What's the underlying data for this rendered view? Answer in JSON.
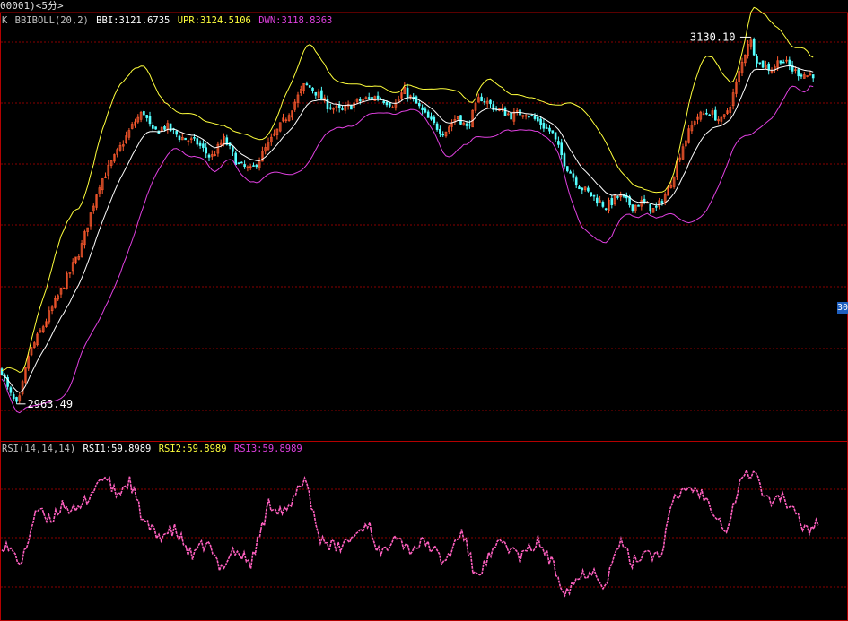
{
  "window_title": "00001)<5分>",
  "main_legend": {
    "prefix": "K",
    "indicator": "BBIBOLL(20,2)",
    "bbi": "BBI:3121.6735",
    "upr": "UPR:3124.5106",
    "dwn": "DWN:3118.8363"
  },
  "rsi_legend": {
    "indicator": "RSI(14,14,14)",
    "rsi1": "RSI1:59.8989",
    "rsi2": "RSI2:59.8989",
    "rsi3": "RSI3:59.8989"
  },
  "right_tag": "30",
  "colors": {
    "background": "#000000",
    "frame": "#b40000",
    "grid": "#8a0000",
    "up_candle": "#ff5a2e",
    "down_candle": "#54ffff",
    "bbi": "#ffffff",
    "upr": "#ffff3c",
    "dwn": "#e040e0",
    "rsi": "#ff60c0",
    "text": "#e0e0e0"
  },
  "chart_data": [
    {
      "type": "candlestick",
      "title": "BBIBOLL(20,2)",
      "interval": "5分",
      "annotations": [
        {
          "label": "2963.49",
          "kind": "low"
        },
        {
          "label": "3130.10",
          "kind": "high"
        }
      ],
      "ylim": [
        2950,
        3145
      ],
      "close_path": [
        [
          0,
          2985
        ],
        [
          10,
          2972
        ],
        [
          20,
          2965
        ],
        [
          32,
          2990
        ],
        [
          50,
          3005
        ],
        [
          70,
          3022
        ],
        [
          90,
          3040
        ],
        [
          110,
          3070
        ],
        [
          130,
          3085
        ],
        [
          150,
          3100
        ],
        [
          160,
          3105
        ],
        [
          170,
          3095
        ],
        [
          185,
          3098
        ],
        [
          200,
          3093
        ],
        [
          220,
          3090
        ],
        [
          235,
          3083
        ],
        [
          250,
          3092
        ],
        [
          265,
          3080
        ],
        [
          280,
          3077
        ],
        [
          300,
          3090
        ],
        [
          320,
          3103
        ],
        [
          340,
          3118
        ],
        [
          350,
          3115
        ],
        [
          365,
          3108
        ],
        [
          380,
          3105
        ],
        [
          400,
          3110
        ],
        [
          420,
          3112
        ],
        [
          440,
          3108
        ],
        [
          450,
          3115
        ],
        [
          465,
          3108
        ],
        [
          480,
          3100
        ],
        [
          495,
          3095
        ],
        [
          510,
          3103
        ],
        [
          520,
          3097
        ],
        [
          535,
          3112
        ],
        [
          550,
          3107
        ],
        [
          570,
          3103
        ],
        [
          585,
          3105
        ],
        [
          600,
          3100
        ],
        [
          615,
          3095
        ],
        [
          630,
          3080
        ],
        [
          645,
          3070
        ],
        [
          660,
          3065
        ],
        [
          675,
          3060
        ],
        [
          690,
          3065
        ],
        [
          705,
          3060
        ],
        [
          715,
          3062
        ],
        [
          730,
          3058
        ],
        [
          745,
          3068
        ],
        [
          760,
          3088
        ],
        [
          775,
          3102
        ],
        [
          790,
          3105
        ],
        [
          805,
          3100
        ],
        [
          815,
          3110
        ],
        [
          825,
          3125
        ],
        [
          835,
          3140
        ],
        [
          845,
          3128
        ],
        [
          860,
          3125
        ],
        [
          870,
          3130
        ],
        [
          885,
          3124
        ],
        [
          900,
          3122
        ],
        [
          910,
          3123
        ]
      ],
      "bbi": "BBI:3121.6735",
      "upr": "UPR:3124.5106",
      "dwn": "DWN:3118.8363"
    },
    {
      "type": "line",
      "title": "RSI(14,14,14)",
      "series": [
        {
          "name": "RSI1",
          "last": 59.8989
        }
      ],
      "ylim": [
        20,
        80
      ],
      "path": [
        [
          0,
          48
        ],
        [
          10,
          45
        ],
        [
          25,
          40
        ],
        [
          40,
          60
        ],
        [
          55,
          55
        ],
        [
          70,
          62
        ],
        [
          85,
          58
        ],
        [
          100,
          65
        ],
        [
          115,
          72
        ],
        [
          130,
          65
        ],
        [
          145,
          70
        ],
        [
          160,
          55
        ],
        [
          175,
          50
        ],
        [
          195,
          52
        ],
        [
          215,
          42
        ],
        [
          230,
          48
        ],
        [
          245,
          38
        ],
        [
          260,
          45
        ],
        [
          280,
          40
        ],
        [
          300,
          62
        ],
        [
          320,
          58
        ],
        [
          340,
          72
        ],
        [
          355,
          50
        ],
        [
          375,
          45
        ],
        [
          395,
          50
        ],
        [
          410,
          55
        ],
        [
          425,
          42
        ],
        [
          440,
          52
        ],
        [
          455,
          45
        ],
        [
          475,
          48
        ],
        [
          495,
          40
        ],
        [
          515,
          52
        ],
        [
          530,
          35
        ],
        [
          545,
          42
        ],
        [
          560,
          48
        ],
        [
          580,
          42
        ],
        [
          600,
          48
        ],
        [
          615,
          40
        ],
        [
          630,
          30
        ],
        [
          645,
          35
        ],
        [
          660,
          38
        ],
        [
          675,
          32
        ],
        [
          690,
          48
        ],
        [
          705,
          40
        ],
        [
          720,
          45
        ],
        [
          735,
          42
        ],
        [
          750,
          62
        ],
        [
          765,
          68
        ],
        [
          780,
          66
        ],
        [
          795,
          60
        ],
        [
          810,
          52
        ],
        [
          825,
          70
        ],
        [
          840,
          74
        ],
        [
          855,
          62
        ],
        [
          870,
          65
        ],
        [
          885,
          58
        ],
        [
          900,
          52
        ],
        [
          912,
          56
        ]
      ]
    }
  ]
}
